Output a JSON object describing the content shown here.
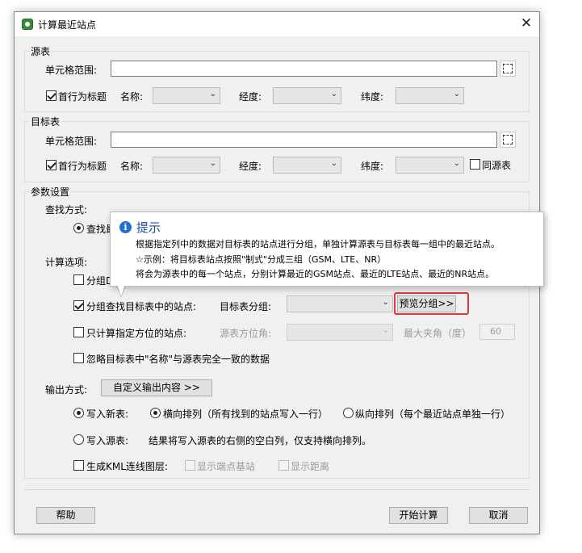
{
  "window": {
    "title": "计算最近站点",
    "close_glyph": "✕"
  },
  "source": {
    "group_label": "源表",
    "range_label": "单元格范围:",
    "range_value": "",
    "header_row_label": "首行为标题",
    "header_row_checked": true,
    "name_label": "名称:",
    "lon_label": "经度:",
    "lat_label": "纬度:",
    "name_value": "",
    "lon_value": "",
    "lat_value": ""
  },
  "target": {
    "group_label": "目标表",
    "range_label": "单元格范围:",
    "range_value": "",
    "header_row_label": "首行为标题",
    "header_row_checked": true,
    "name_label": "名称:",
    "lon_label": "经度:",
    "lat_label": "纬度:",
    "same_as_source_label": "同源表",
    "same_as_source_checked": false
  },
  "params": {
    "group_label": "参数设置",
    "lookup_mode_label": "查找方式:",
    "lookup_option_partial": "查找最",
    "lookup_option_checked": true,
    "calc_options_label": "计算选项:",
    "group_option_partial": "分组D",
    "group_option_checked": false,
    "group_lookup_label": "分组查找目标表中的站点:",
    "group_lookup_checked": true,
    "target_group_label": "目标表分组:",
    "target_group_value": "",
    "preview_group_button": "预览分组>>",
    "direction_only_label": "只计算指定方位的站点:",
    "direction_only_checked": false,
    "source_direction_label": "源表方位角:",
    "max_angle_label": "最大夹角（度）",
    "max_angle_value": "60",
    "ignore_same_name_label": "忽略目标表中\"名称\"与源表完全一致的数据",
    "ignore_same_name_checked": false,
    "output_mode_label": "输出方式:",
    "custom_output_button": "自定义输出内容 >>",
    "write_new_label": "写入新表:",
    "write_new_checked": true,
    "horizontal_label": "横向排列（所有找到的站点写入一行）",
    "horizontal_checked": true,
    "vertical_label": "纵向排列（每个最近站点单独一行）",
    "vertical_checked": false,
    "write_source_label": "写入源表:",
    "write_source_checked": false,
    "write_source_note": "结果将写入源表的右侧的空白列，仅支持横向排列。",
    "kml_label": "生成KML连线图层:",
    "kml_checked": false,
    "show_endpoint_label": "显示端点基站",
    "show_distance_label": "显示距离"
  },
  "footer": {
    "help_button": "帮助",
    "start_button": "开始计算",
    "cancel_button": "取消"
  },
  "tooltip": {
    "title": "提示",
    "line1": "根据指定列中的数据对目标表的站点进行分组，单独计算源表与目标表每一组中的最近站点。",
    "line2": "☆示例：将目标表站点按照\"制式\"分成三组（GSM、LTE、NR）",
    "line3": "将会为源表中的每一个站点，分别计算最近的GSM站点、最近的LTE站点、最近的NR站点。"
  }
}
